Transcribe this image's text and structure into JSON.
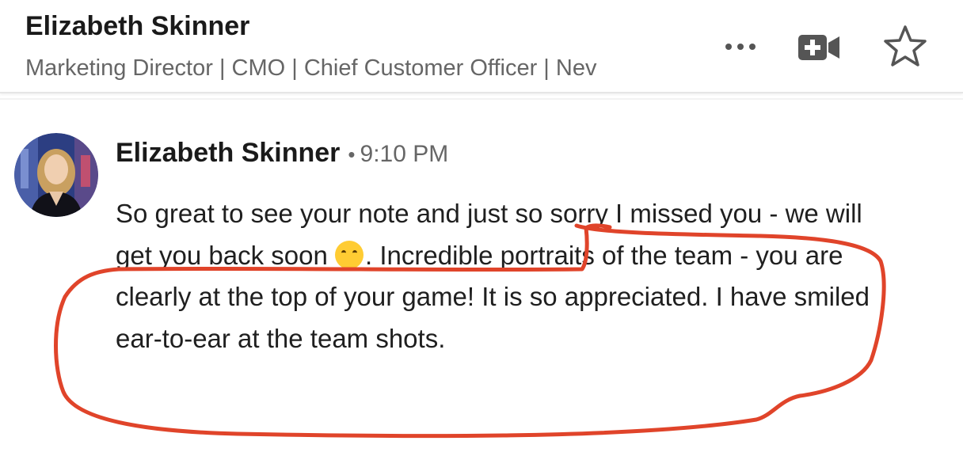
{
  "header": {
    "name": "Elizabeth Skinner",
    "headline": "Marketing Director | CMO | Chief Customer Officer | Nev",
    "icons": {
      "more": "more-horizontal-icon",
      "video": "video-call-icon",
      "star": "star-icon"
    }
  },
  "message": {
    "sender": "Elizabeth Skinner",
    "separator": "•",
    "time": "9:10 PM",
    "avatar": "avatar-photo",
    "text_part1": "So great to see your note and just so sorry I missed you - we will get you back soon ",
    "emoji": "hugging-face-emoji",
    "text_part2": ". Incredible portraits of the team - you are clearly at the top of your game! It is so appreciated. I have smiled ear-to-ear at the team shots."
  },
  "colors": {
    "annotation": "#e0442a",
    "muted_text": "#666666",
    "text": "#1f1f1f"
  }
}
